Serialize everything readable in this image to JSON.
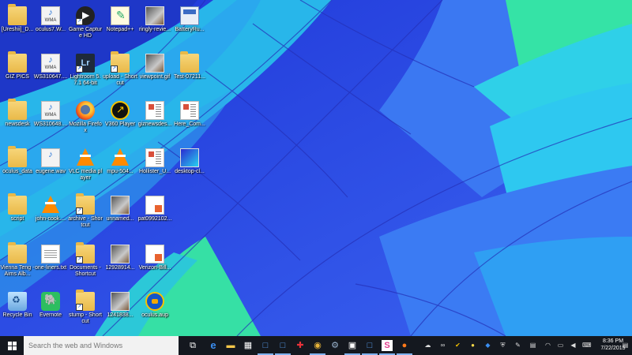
{
  "desktop": {
    "icons": [
      {
        "label": "[Ureshii]_D...",
        "icon": "folder-icon"
      },
      {
        "label": "oculus7.W...",
        "icon": "wma-file-icon"
      },
      {
        "label": "Game Capture HD",
        "icon": "game-capture-icon"
      },
      {
        "label": "Notepad++",
        "icon": "notepad-plus-plus-icon"
      },
      {
        "label": "ringly-revie...",
        "icon": "image-file-icon"
      },
      {
        "label": "BatteryRu...",
        "icon": "battery-report-icon"
      },
      {
        "label": "GIZ PICS",
        "icon": "folder-icon"
      },
      {
        "label": "WS310647....",
        "icon": "wma-file-icon"
      },
      {
        "label": "Lightroom 5.7.1 64-bit",
        "icon": "lightroom-icon"
      },
      {
        "label": "upload - Shortcut",
        "icon": "folder-shortcut-icon"
      },
      {
        "label": "viewpoint.gif",
        "icon": "image-file-icon"
      },
      {
        "label": "Test-07211...",
        "icon": "folder-icon"
      },
      {
        "label": "newsdesk",
        "icon": "folder-icon"
      },
      {
        "label": "WS310648....",
        "icon": "wma-file-icon"
      },
      {
        "label": "Mozilla Firefox",
        "icon": "firefox-icon"
      },
      {
        "label": "V360 Player",
        "icon": "v360-player-icon"
      },
      {
        "label": "giznewsdes...",
        "icon": "document-icon"
      },
      {
        "label": "Here_Com...",
        "icon": "document-icon"
      },
      {
        "label": "oculus_data",
        "icon": "folder-icon"
      },
      {
        "label": "eugene.wav",
        "icon": "wma-file-icon"
      },
      {
        "label": "VLC media player",
        "icon": "vlc-icon"
      },
      {
        "label": "mpu-504...",
        "icon": "vlc-icon"
      },
      {
        "label": "Hollister_U...",
        "icon": "document-icon"
      },
      {
        "label": "desktop-cl...",
        "icon": "desktop-image-icon"
      },
      {
        "label": "script",
        "icon": "folder-icon"
      },
      {
        "label": "john-cook....",
        "icon": "vlc-icon"
      },
      {
        "label": "archive - Shortcut",
        "icon": "folder-shortcut-icon"
      },
      {
        "label": "unnamed...",
        "icon": "image-file-icon"
      },
      {
        "label": "pat0992102...",
        "icon": "pdf-document-icon"
      },
      {
        "label": "Vienna Teng - Aims Alb...",
        "icon": "folder-icon"
      },
      {
        "label": "one-liners.txt",
        "icon": "text-file-icon"
      },
      {
        "label": "Documents - Shortcut",
        "icon": "folder-shortcut-icon"
      },
      {
        "label": "12928914...",
        "icon": "image-file-icon"
      },
      {
        "label": "Verizon-Bill...",
        "icon": "pdf-document-icon"
      },
      {
        "label": "Recycle Bin",
        "icon": "recycle-bin-icon"
      },
      {
        "label": "Evernote",
        "icon": "evernote-icon"
      },
      {
        "label": "stump - Shortcut",
        "icon": "folder-shortcut-icon"
      },
      {
        "label": "1241838...",
        "icon": "image-file-icon"
      },
      {
        "label": "oculus.aup",
        "icon": "audacity-icon"
      }
    ]
  },
  "taskbar": {
    "search_placeholder": "Search the web and Windows",
    "pinned": [
      {
        "name": "task-view-icon",
        "glyph": "⧉"
      },
      {
        "name": "edge-icon",
        "glyph": "e"
      },
      {
        "name": "file-explorer-icon",
        "glyph": "▬"
      },
      {
        "name": "store-icon",
        "glyph": "▦"
      },
      {
        "name": "window-icon-1",
        "glyph": "□"
      },
      {
        "name": "window-icon-2",
        "glyph": "□"
      },
      {
        "name": "puzzle-app-icon",
        "glyph": "✚"
      },
      {
        "name": "chrome-icon",
        "glyph": "◉"
      },
      {
        "name": "steam-icon",
        "glyph": "⚙"
      },
      {
        "name": "photo-app-icon",
        "glyph": "▣"
      },
      {
        "name": "window-icon-3",
        "glyph": "□"
      },
      {
        "name": "slack-icon",
        "glyph": "S"
      },
      {
        "name": "firefox-taskbar-icon",
        "glyph": "●"
      }
    ],
    "tray": [
      {
        "name": "cloud-icon",
        "glyph": "☁"
      },
      {
        "name": "link-icon",
        "glyph": "∞"
      },
      {
        "name": "norton-icon",
        "glyph": "✔"
      },
      {
        "name": "yellow-app-icon",
        "glyph": "●"
      },
      {
        "name": "dropbox-icon",
        "glyph": "◆"
      },
      {
        "name": "shield-icon",
        "glyph": "⛨"
      },
      {
        "name": "pen-icon",
        "glyph": "✎"
      },
      {
        "name": "store-tray-icon",
        "glyph": "▤"
      },
      {
        "name": "wifi-icon",
        "glyph": "◠"
      },
      {
        "name": "network-icon",
        "glyph": "▭"
      },
      {
        "name": "volume-icon",
        "glyph": "◀"
      },
      {
        "name": "keyboard-icon",
        "glyph": "⌨"
      }
    ],
    "time": "8:36 PM",
    "date": "7/22/2015",
    "notification_glyph": "▤"
  }
}
